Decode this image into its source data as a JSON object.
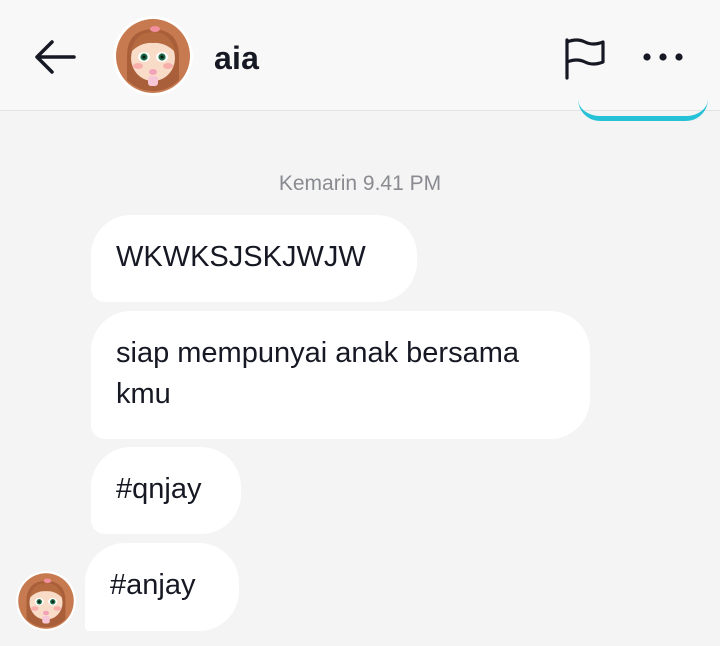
{
  "header": {
    "back_icon": "arrow-left-icon",
    "contact_name": "aia",
    "report_icon": "flag-icon",
    "more_icon": "more-horizontal-icon"
  },
  "conversation": {
    "timestamp": "Kemarin 9.41 PM",
    "messages": [
      {
        "text": "WKWKSJSKJWJW"
      },
      {
        "text": "siap mempunyai anak bersama kmu"
      },
      {
        "text": "#qnjay"
      },
      {
        "text": "#anjay"
      }
    ]
  },
  "colors": {
    "background": "#f4f4f4",
    "bubble": "#ffffff",
    "accent": "#25c1d6",
    "timestamp": "#8a8b91"
  }
}
